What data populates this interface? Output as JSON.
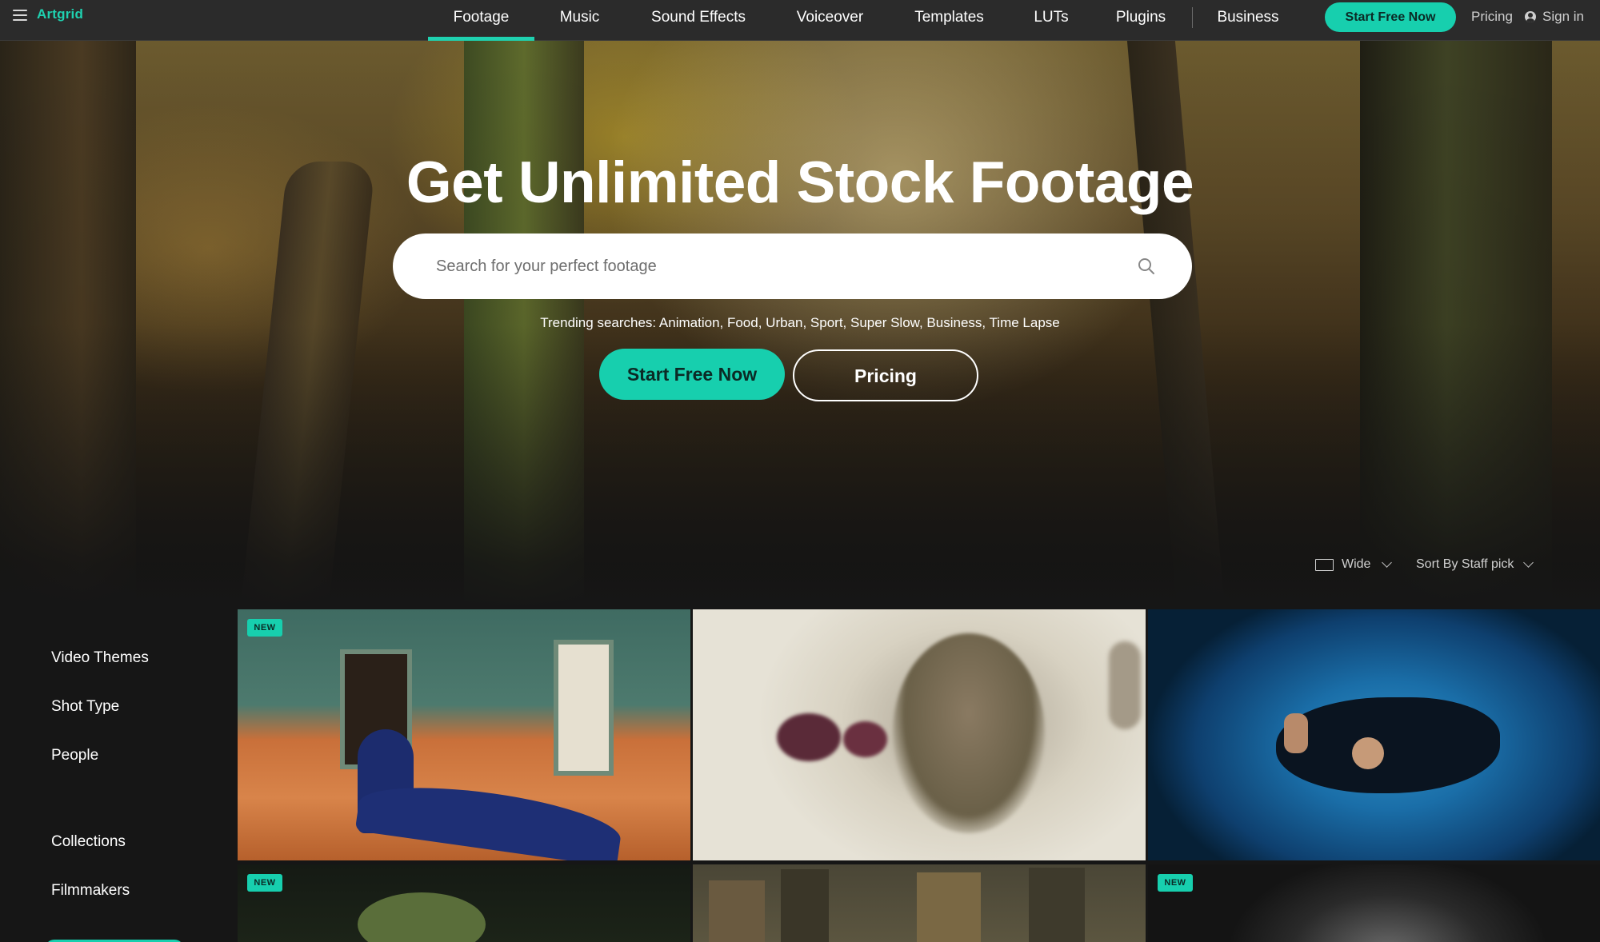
{
  "nav": {
    "logo": "Artgrid",
    "tabs": [
      {
        "label": "Footage",
        "active": true
      },
      {
        "label": "Music"
      },
      {
        "label": "Sound Effects"
      },
      {
        "label": "Voiceover"
      },
      {
        "label": "Templates"
      },
      {
        "label": "LUTs"
      },
      {
        "label": "Plugins"
      },
      {
        "label": "Business"
      }
    ],
    "cta_label": "Start Free Now",
    "pricing_label": "Pricing",
    "signin_label": "Sign in"
  },
  "hero": {
    "title": "Get Unlimited Stock Footage",
    "search_placeholder": "Search for your perfect footage",
    "trending_text": "Trending searches: Animation, Food, Urban, Sport, Super Slow, Business, Time Lapse",
    "cta_label": "Start Free Now",
    "pricing_label": "Pricing"
  },
  "toolbar": {
    "view_label": "Wide",
    "sort_label": "Sort By Staff pick"
  },
  "sidebar": {
    "items": [
      "Video Themes",
      "Shot Type",
      "People",
      "Collections",
      "Filmmakers"
    ]
  },
  "grid": {
    "tiles": [
      {
        "badge": "NEW"
      },
      {
        "badge": ""
      },
      {
        "badge": ""
      },
      {
        "badge": "NEW"
      },
      {
        "badge": ""
      },
      {
        "badge": "NEW"
      }
    ]
  },
  "colors": {
    "accent": "#17cfae",
    "topbar": "#2b2b2b",
    "background": "#161616"
  }
}
